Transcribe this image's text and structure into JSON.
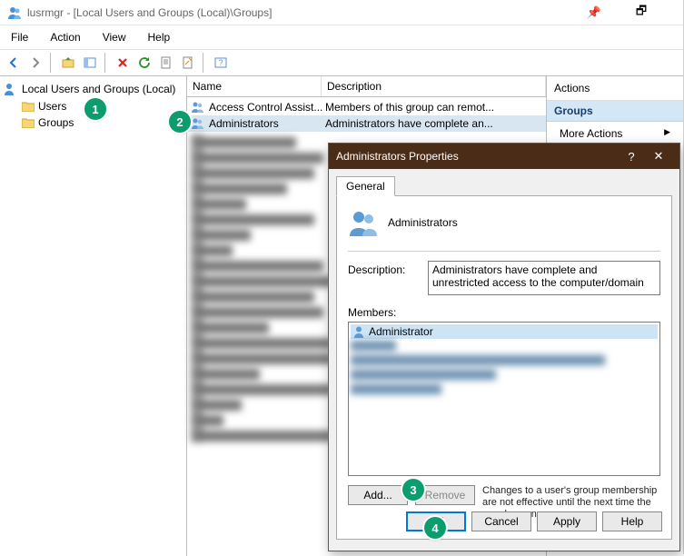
{
  "window": {
    "title": "lusrmgr - [Local Users and Groups (Local)\\Groups]"
  },
  "menu": {
    "file": "File",
    "action": "Action",
    "view": "View",
    "help": "Help"
  },
  "tree": {
    "root": "Local Users and Groups (Local)",
    "users": "Users",
    "groups": "Groups"
  },
  "list": {
    "col_name": "Name",
    "col_desc": "Description",
    "rows": [
      {
        "name": "Access Control Assist...",
        "desc": "Members of this group can remot..."
      },
      {
        "name": "Administrators",
        "desc": "Administrators have complete an..."
      }
    ]
  },
  "actions": {
    "header": "Actions",
    "group": "Groups",
    "more": "More Actions"
  },
  "dialog": {
    "title": "Administrators Properties",
    "tab_general": "General",
    "group_name": "Administrators",
    "desc_label": "Description:",
    "desc_value": "Administrators have complete and unrestricted access to the computer/domain",
    "members_label": "Members:",
    "member0": "Administrator",
    "add": "Add...",
    "remove": "Remove",
    "note": "Changes to a user's group membership are not effective until the next time the user logs on.",
    "ok": "OK",
    "cancel": "Cancel",
    "apply": "Apply",
    "help": "Help"
  },
  "badges": {
    "b1": "1",
    "b2": "2",
    "b3": "3",
    "b4": "4"
  }
}
